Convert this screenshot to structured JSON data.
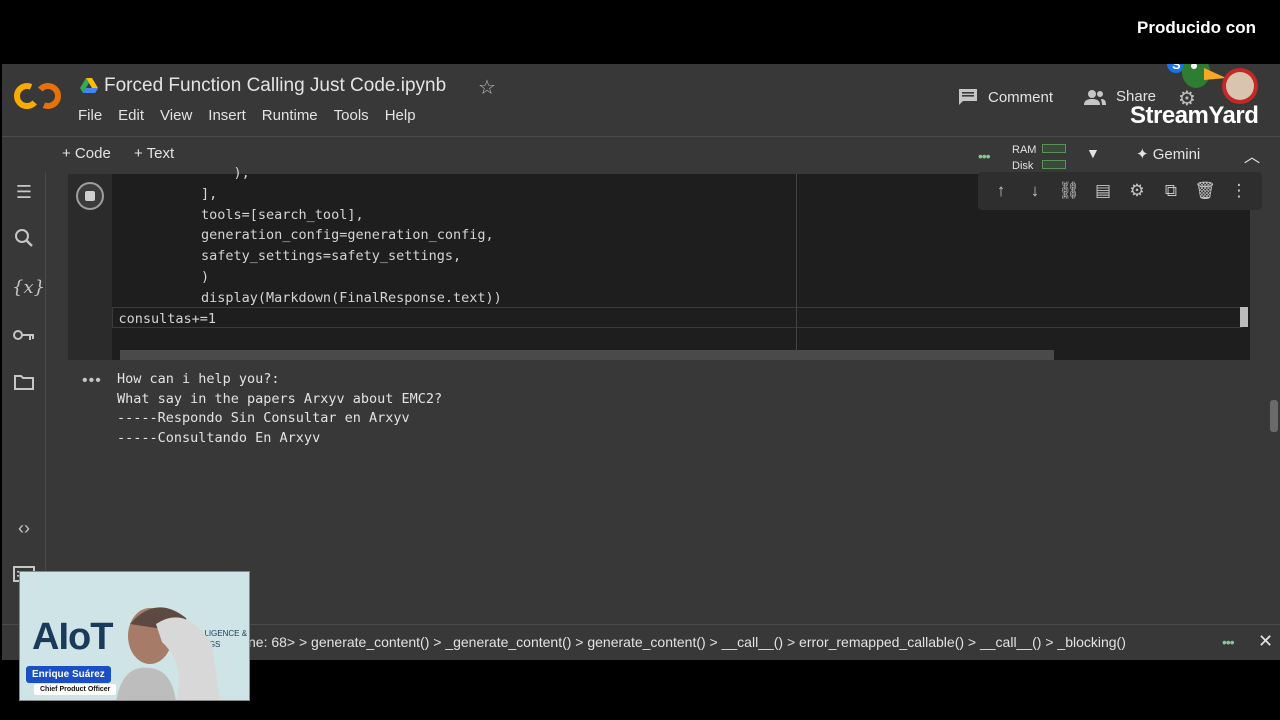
{
  "stream": {
    "produced_by": "Producido con",
    "brand": "StreamYard"
  },
  "header": {
    "title": "Forced Function Calling Just Code.ipynb",
    "menu": [
      "File",
      "Edit",
      "View",
      "Insert",
      "Runtime",
      "Tools",
      "Help"
    ],
    "comment_label": "Comment",
    "share_label": "Share"
  },
  "toolbar": {
    "add_code": "+ Code",
    "add_text": "+ Text",
    "ram_label": "RAM",
    "disk_label": "Disk",
    "gemini_label": "Gemini"
  },
  "cell": {
    "lines": [
      "            ),",
      "        ],",
      "        tools=[search_tool],",
      "        generation_config=generation_config,",
      "        safety_settings=safety_settings,",
      "        )",
      "        display(Markdown(FinalResponse.text))",
      "    consultas+=1"
    ]
  },
  "output": {
    "lines": [
      "How can i help you?:",
      "What say in the papers Arxyv about EMC2?",
      "-----Respondo Sin Consultar en Arxyv",
      "-----Consultando En Arxyv"
    ]
  },
  "statusbar": {
    "text": "ne: 68> > generate_content() > _generate_content() > generate_content() > __call__() > error_remapped_callable() > __call__() > _blocking()"
  },
  "webcam": {
    "brand": "AIoT",
    "tagline_1": "AL INTELLIGENCE &",
    "tagline_2": "T OF THINGS",
    "name": "Enrique Suárez",
    "role": "Chief Product Officer"
  },
  "colors": {
    "accent_green": "#81c995",
    "colab_orange": "#f9ab00",
    "colab_dark_orange": "#e8710a"
  }
}
